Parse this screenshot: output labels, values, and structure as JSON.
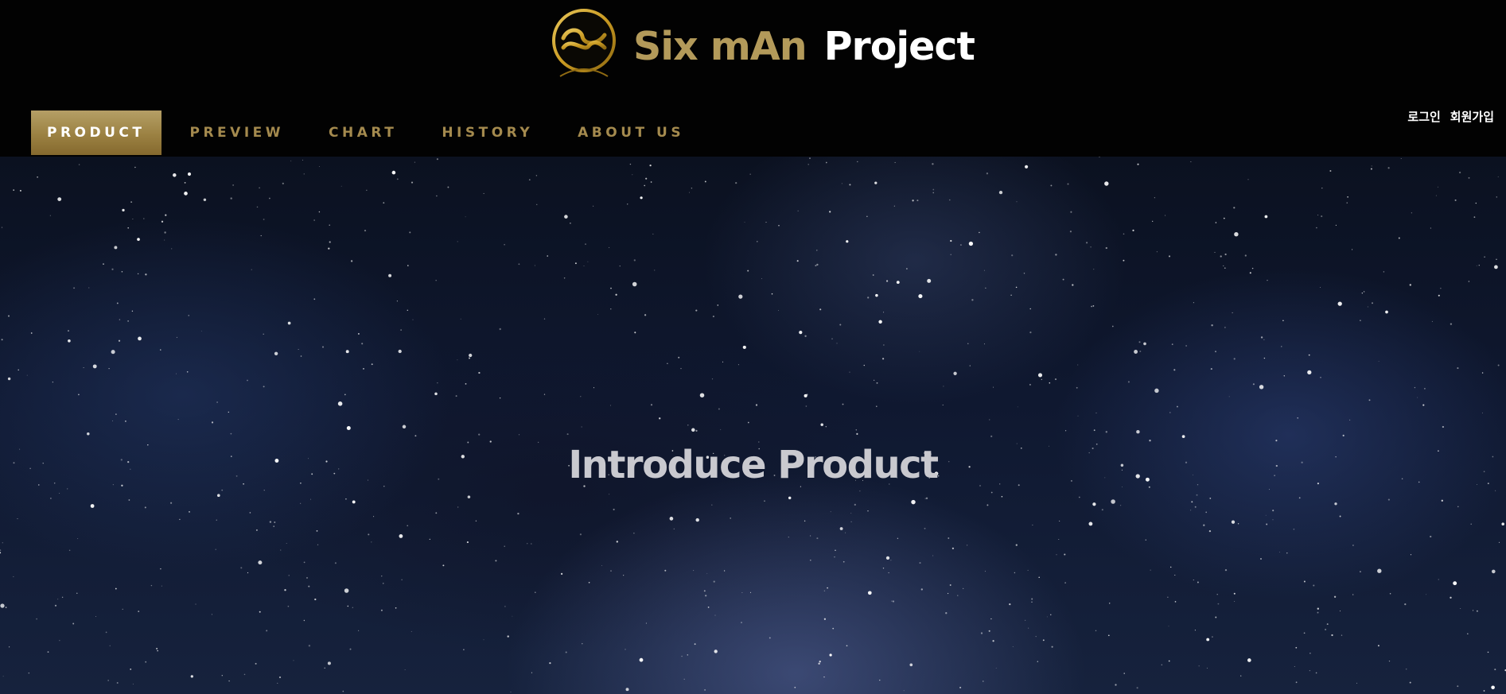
{
  "header": {
    "brand_name": "Six mAn",
    "brand_project": "Project",
    "colors": {
      "gold": "#b39a5a",
      "nav_gold": "#a48a4e",
      "active_bg": "#9b8142"
    }
  },
  "nav": {
    "items": [
      {
        "label": "PRODUCT",
        "active": true
      },
      {
        "label": "PREVIEW",
        "active": false
      },
      {
        "label": "CHART",
        "active": false
      },
      {
        "label": "HISTORY",
        "active": false
      },
      {
        "label": "ABOUT US",
        "active": false
      }
    ]
  },
  "auth": {
    "login": "로그인",
    "signup": "회원가입"
  },
  "hero": {
    "title": "Introduce Product",
    "background": "starfield-night-sky"
  }
}
